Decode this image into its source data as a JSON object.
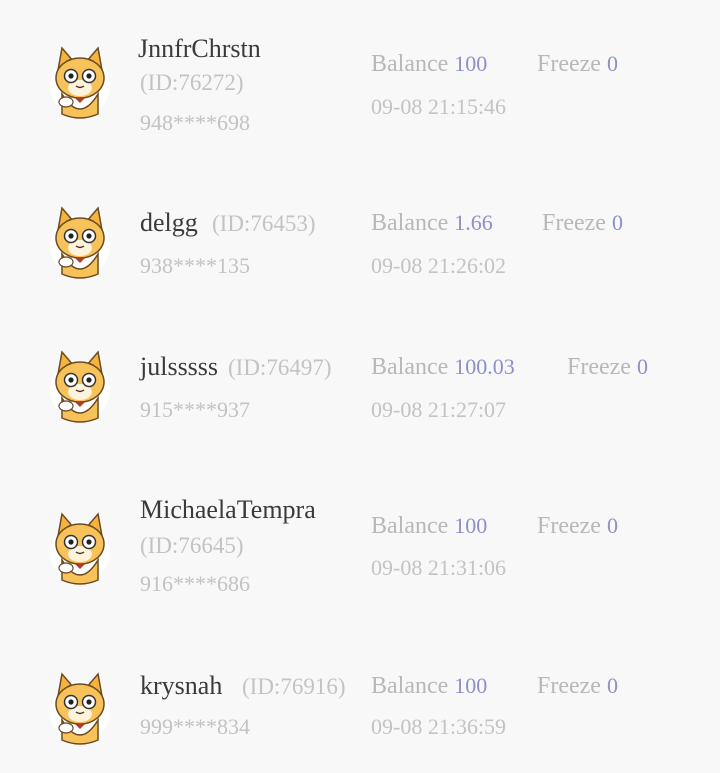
{
  "labels": {
    "balance": "Balance",
    "freeze": "Freeze"
  },
  "users": [
    {
      "name": "JnnfrChrstn",
      "id": "(ID:76272)",
      "phone": "948****698",
      "balance": "100",
      "freeze": "0",
      "time": "09-08 21:15:46"
    },
    {
      "name": "delgg",
      "id": "(ID:76453)",
      "phone": "938****135",
      "balance": "1.66",
      "freeze": "0",
      "time": "09-08 21:26:02"
    },
    {
      "name": "julsssss",
      "id": "(ID:76497)",
      "phone": "915****937",
      "balance": "100.03",
      "freeze": "0",
      "time": "09-08 21:27:07"
    },
    {
      "name": "MichaelaTempra",
      "id": "(ID:76645)",
      "phone": "916****686",
      "balance": "100",
      "freeze": "0",
      "time": "09-08 21:31:06"
    },
    {
      "name": "krysnah",
      "id": "(ID:76916)",
      "phone": "999****834",
      "balance": "100",
      "freeze": "0",
      "time": "09-08 21:36:59"
    }
  ]
}
